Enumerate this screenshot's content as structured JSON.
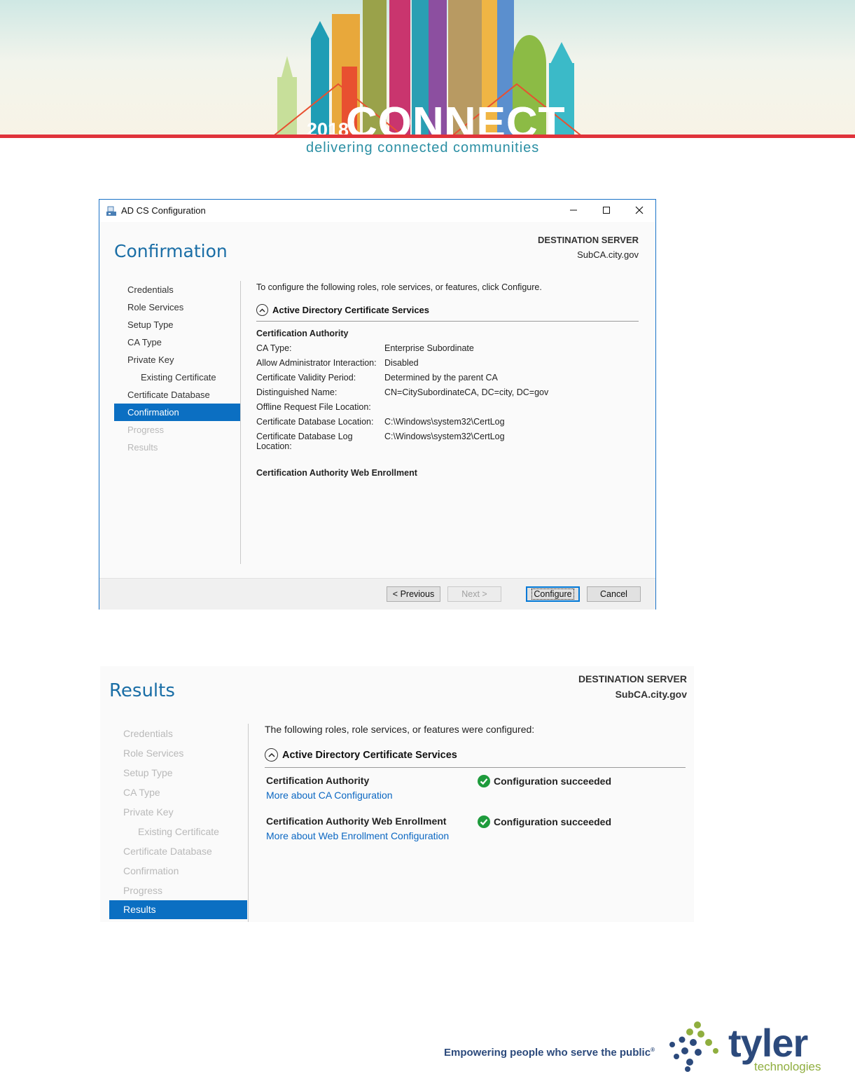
{
  "banner": {
    "year": "2018",
    "logo": "CONNECT",
    "tagline": "delivering connected communities"
  },
  "dialog": {
    "window_title": "AD CS Configuration",
    "heading": "Confirmation",
    "destination_label": "DESTINATION SERVER",
    "destination_server": "SubCA.city.gov",
    "nav": [
      {
        "label": "Credentials",
        "state": "normal"
      },
      {
        "label": "Role Services",
        "state": "normal"
      },
      {
        "label": "Setup Type",
        "state": "normal"
      },
      {
        "label": "CA Type",
        "state": "normal"
      },
      {
        "label": "Private Key",
        "state": "normal"
      },
      {
        "label": "Existing Certificate",
        "state": "normal"
      },
      {
        "label": "Certificate Database",
        "state": "normal"
      },
      {
        "label": "Confirmation",
        "state": "active"
      },
      {
        "label": "Progress",
        "state": "disabled"
      },
      {
        "label": "Results",
        "state": "disabled"
      }
    ],
    "intro": "To configure the following roles, role services, or features, click Configure.",
    "section_title": "Active Directory Certificate Services",
    "ca_heading": "Certification Authority",
    "properties": [
      {
        "key": "CA Type:",
        "value": "Enterprise Subordinate"
      },
      {
        "key": "Allow Administrator Interaction:",
        "value": "Disabled"
      },
      {
        "key": "Certificate Validity Period:",
        "value": "Determined by the parent CA"
      },
      {
        "key": "Distinguished Name:",
        "value": "CN=CitySubordinateCA, DC=city, DC=gov"
      },
      {
        "key": "Offline Request File Location:",
        "value": ""
      },
      {
        "key": "Certificate Database Location:",
        "value": "C:\\Windows\\system32\\CertLog"
      },
      {
        "key": "Certificate Database Log Location:",
        "value": "C:\\Windows\\system32\\CertLog"
      }
    ],
    "web_enrollment_heading": "Certification Authority Web Enrollment",
    "buttons": {
      "previous": "< Previous",
      "next": "Next >",
      "configure": "Configure",
      "cancel": "Cancel"
    }
  },
  "results": {
    "heading": "Results",
    "destination_label": "DESTINATION SERVER",
    "destination_server": "SubCA.city.gov",
    "nav": [
      {
        "label": "Credentials",
        "state": "disabled"
      },
      {
        "label": "Role Services",
        "state": "disabled"
      },
      {
        "label": "Setup Type",
        "state": "disabled"
      },
      {
        "label": "CA Type",
        "state": "disabled"
      },
      {
        "label": "Private Key",
        "state": "disabled"
      },
      {
        "label": "Existing Certificate",
        "state": "disabled"
      },
      {
        "label": "Certificate Database",
        "state": "disabled"
      },
      {
        "label": "Confirmation",
        "state": "disabled"
      },
      {
        "label": "Progress",
        "state": "disabled"
      },
      {
        "label": "Results",
        "state": "active"
      }
    ],
    "intro": "The following roles, role services, or features were configured:",
    "section_title": "Active Directory Certificate Services",
    "items": [
      {
        "name": "Certification Authority",
        "link": "More about CA Configuration",
        "status": "Configuration succeeded"
      },
      {
        "name": "Certification Authority Web Enrollment",
        "link": "More about Web Enrollment Configuration",
        "status": "Configuration succeeded"
      }
    ]
  },
  "branding": {
    "slogan": "Empowering people who serve the public",
    "company": "tyler",
    "company_sub": "technologies"
  },
  "colors": {
    "accent": "#0b6fc2",
    "heading": "#1a6ea6",
    "success": "#1e9b3c",
    "brand_red": "#e0323a",
    "tyler_navy": "#2c4a7c",
    "tyler_green": "#8fae3e"
  }
}
